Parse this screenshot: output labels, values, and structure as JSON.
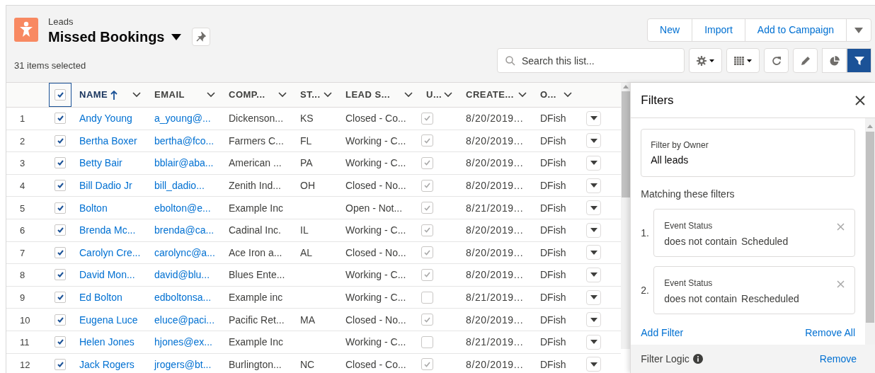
{
  "header": {
    "object_label": "Leads",
    "list_name": "Missed Bookings",
    "selected_count": "31 items selected"
  },
  "actions": [
    "New",
    "Import",
    "Add to Campaign"
  ],
  "search": {
    "placeholder": "Search this list..."
  },
  "toolbar": [
    {
      "kind": "gear",
      "dropdown": true,
      "selected": false
    },
    {
      "kind": "table",
      "dropdown": true,
      "selected": false
    },
    {
      "kind": "refresh",
      "dropdown": false,
      "selected": false
    },
    {
      "kind": "pencil",
      "dropdown": false,
      "selected": false
    },
    {
      "kind": "chart",
      "dropdown": false,
      "selected": false
    },
    {
      "kind": "filter",
      "dropdown": false,
      "selected": true
    }
  ],
  "table": {
    "all_selected": true,
    "columns": [
      {
        "label": "NAME",
        "sorted": true
      },
      {
        "label": "EMAIL",
        "sorted": false
      },
      {
        "label": "COMP...",
        "sorted": false
      },
      {
        "label": "ST...",
        "sorted": false
      },
      {
        "label": "LEAD S...",
        "sorted": false
      },
      {
        "label": "U...",
        "sorted": false
      },
      {
        "label": "CREATE...",
        "sorted": false
      },
      {
        "label": "O...",
        "sorted": false
      }
    ],
    "rows": [
      {
        "num": "1",
        "selected": true,
        "name": "Andy Young",
        "email": "a_young@...",
        "company": "Dickenson...",
        "state": "KS",
        "lead_status": "Closed - Co...",
        "unread": true,
        "created": "8/20/2019...",
        "owner": "DFish"
      },
      {
        "num": "2",
        "selected": true,
        "name": "Bertha Boxer",
        "email": "bertha@fco...",
        "company": "Farmers C...",
        "state": "FL",
        "lead_status": "Working - C...",
        "unread": true,
        "created": "8/20/2019...",
        "owner": "DFish"
      },
      {
        "num": "3",
        "selected": true,
        "name": "Betty Bair",
        "email": "bblair@aba...",
        "company": "American ...",
        "state": "PA",
        "lead_status": "Working - C...",
        "unread": true,
        "created": "8/20/2019...",
        "owner": "DFish"
      },
      {
        "num": "4",
        "selected": true,
        "name": "Bill Dadio Jr",
        "email": "bill_dadio...",
        "company": "Zenith Ind...",
        "state": "OH",
        "lead_status": "Closed - No...",
        "unread": true,
        "created": "8/20/2019...",
        "owner": "DFish"
      },
      {
        "num": "5",
        "selected": true,
        "name": "Bolton",
        "email": "ebolton@e...",
        "company": "Example Inc",
        "lead_status": "Open - Not...",
        "unread": true,
        "created": "8/21/2019...",
        "owner": "DFish"
      },
      {
        "num": "6",
        "selected": true,
        "name": "Brenda Mc...",
        "email": "brenda@ca...",
        "company": "Cadinal Inc.",
        "state": "IL",
        "lead_status": "Working - C...",
        "unread": true,
        "created": "8/20/2019...",
        "owner": "DFish"
      },
      {
        "num": "7",
        "selected": true,
        "name": "Carolyn Cre...",
        "email": "carolync@a...",
        "company": "Ace Iron a...",
        "state": "AL",
        "lead_status": "Closed - No...",
        "unread": true,
        "created": "8/20/2019...",
        "owner": "DFish"
      },
      {
        "num": "8",
        "selected": true,
        "name": "David Mon...",
        "email": "david@blu...",
        "company": "Blues Ente...",
        "lead_status": "Working - C...",
        "unread": true,
        "created": "8/20/2019...",
        "owner": "DFish"
      },
      {
        "num": "9",
        "selected": true,
        "name": "Ed Bolton",
        "email": "edboltonsa...",
        "company": "Example inc",
        "lead_status": "Working - C...",
        "unread": false,
        "created": "8/21/2019...",
        "owner": "DFish"
      },
      {
        "num": "10",
        "selected": true,
        "name": "Eugena Luce",
        "email": "eluce@paci...",
        "company": "Pacific Ret...",
        "state": "MA",
        "lead_status": "Closed - No...",
        "unread": true,
        "created": "8/20/2019...",
        "owner": "DFish"
      },
      {
        "num": "11",
        "selected": true,
        "name": "Helen Jones",
        "email": "hjones@ex...",
        "company": "Example Inc",
        "lead_status": "Working - C...",
        "unread": false,
        "created": "8/21/2019...",
        "owner": "DFish"
      },
      {
        "num": "12",
        "selected": true,
        "name": "Jack Rogers",
        "email": "jrogers@bt...",
        "company": "Burlington...",
        "state": "NC",
        "lead_status": "Closed - Co...",
        "unread": true,
        "created": "8/20/2019...",
        "owner": "DFish"
      }
    ]
  },
  "filters_panel": {
    "title": "Filters",
    "owner_label": "Filter by Owner",
    "owner_value": "All leads",
    "matching_label": "Matching these filters",
    "filters": [
      {
        "number": "1.",
        "field": "Event Status",
        "operator": "does not contain",
        "value": "Scheduled"
      },
      {
        "number": "2.",
        "field": "Event Status",
        "operator": "does not contain",
        "value": "Rescheduled"
      }
    ],
    "add_filter": "Add Filter",
    "remove_all": "Remove All",
    "logic_label": "Filter Logic",
    "logic_remove": "Remove"
  }
}
